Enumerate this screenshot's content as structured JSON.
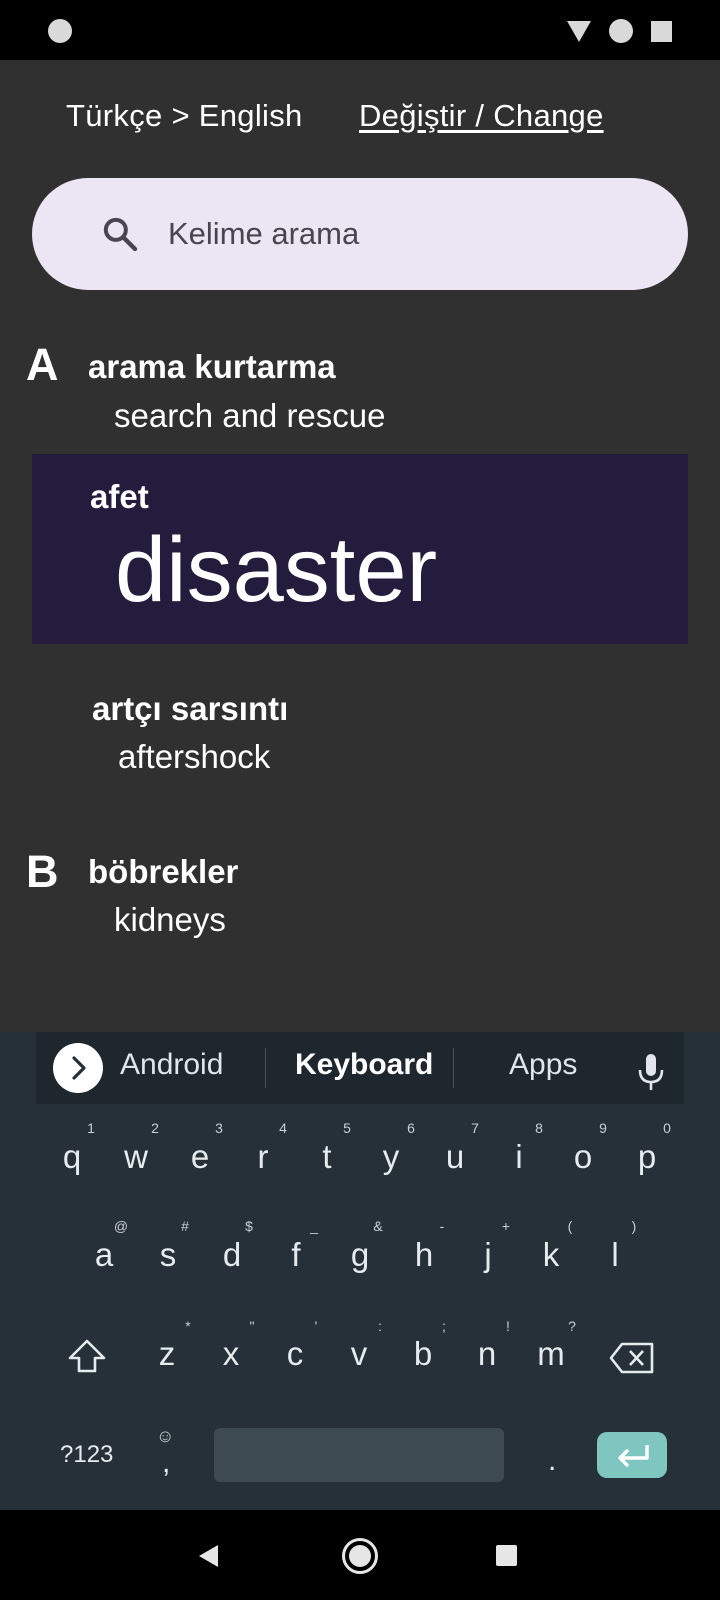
{
  "language": {
    "pair": "Türkçe > English",
    "change": "Değiştir / Change"
  },
  "search": {
    "placeholder": "Kelime arama",
    "icon": "search-icon"
  },
  "entries": [
    {
      "letter": "A",
      "term": "arama kurtarma",
      "translation": "search and rescue"
    },
    {
      "term": "afet",
      "translation": "disaster",
      "highlighted": true
    },
    {
      "term": "artçı sarsıntı",
      "translation": "aftershock"
    },
    {
      "letter": "B",
      "term": "böbrekler",
      "translation": "kidneys"
    }
  ],
  "keyboard": {
    "suggestions": [
      "Android",
      "Keyboard",
      "Apps"
    ],
    "row1": [
      "q",
      "w",
      "e",
      "r",
      "t",
      "y",
      "u",
      "i",
      "o",
      "p"
    ],
    "row1_hints": [
      "1",
      "2",
      "3",
      "4",
      "5",
      "6",
      "7",
      "8",
      "9",
      "0"
    ],
    "row2": [
      "a",
      "s",
      "d",
      "f",
      "g",
      "h",
      "j",
      "k",
      "l"
    ],
    "row2_hints": [
      "@",
      "#",
      "$",
      "_",
      "&",
      "-",
      "+",
      "(",
      ")"
    ],
    "row3": [
      "z",
      "x",
      "c",
      "v",
      "b",
      "n",
      "m"
    ],
    "row3_hints": [
      "*",
      "\"",
      "'",
      ":",
      ";",
      "!",
      "?"
    ],
    "symbols_label": "?123",
    "comma": ",",
    "emoji_hint": "☺",
    "period": "."
  },
  "colors": {
    "background": "#303030",
    "highlight": "#241c3d",
    "search_bg": "#ece5f3",
    "keyboard_bg": "#263038",
    "enter_key": "#7fc6c0"
  }
}
